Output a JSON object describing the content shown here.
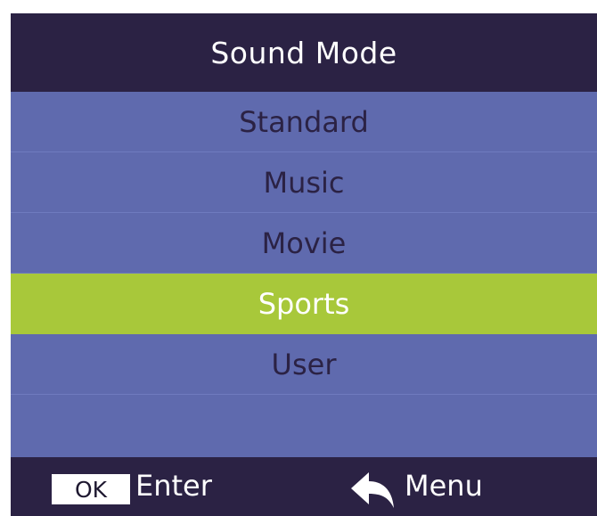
{
  "header": {
    "title": "Sound Mode"
  },
  "list": {
    "items": [
      {
        "label": "Standard",
        "selected": false
      },
      {
        "label": "Music",
        "selected": false
      },
      {
        "label": "Movie",
        "selected": false
      },
      {
        "label": "Sports",
        "selected": true
      },
      {
        "label": "User",
        "selected": false
      },
      {
        "label": "",
        "selected": false
      }
    ]
  },
  "footer": {
    "ok_key": "OK",
    "enter_label": "Enter",
    "back_icon": "back-arrow-icon",
    "menu_label": "Menu"
  },
  "colors": {
    "header_bg": "#2b2244",
    "list_bg": "#5f6aae",
    "selected_bg": "#a8c83a",
    "item_text": "#2b2244",
    "selected_text": "#ffffff"
  }
}
